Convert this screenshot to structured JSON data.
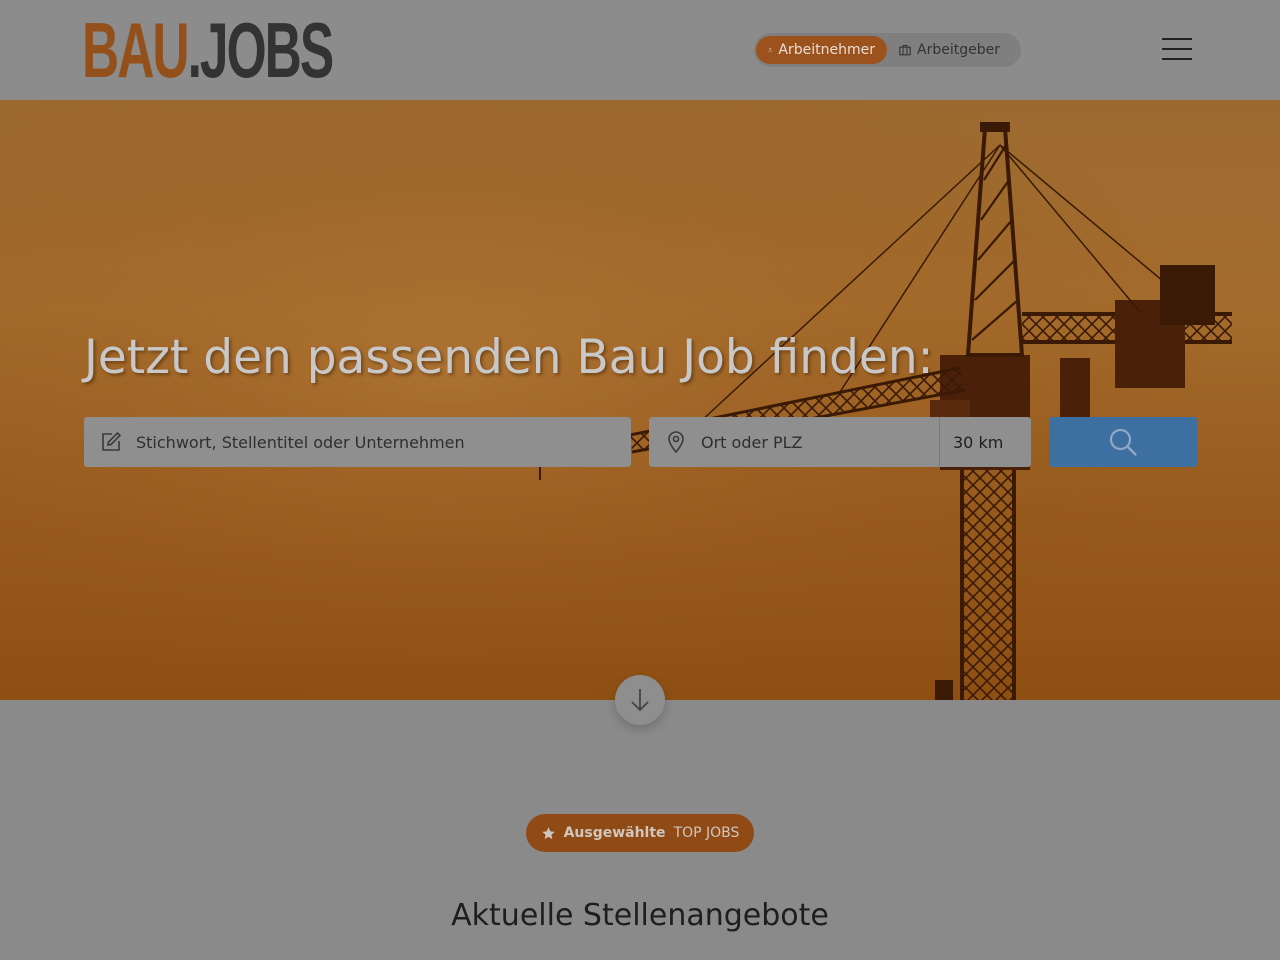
{
  "header": {
    "logo": {
      "part_a": "BAU",
      "part_b": ".JOBS"
    },
    "roles": [
      {
        "label": "Arbeitnehmer",
        "icon": "person-icon",
        "active": true
      },
      {
        "label": "Arbeitgeber",
        "icon": "briefcase-icon",
        "active": false
      }
    ],
    "menu_icon": "hamburger-icon"
  },
  "hero": {
    "title": "Jetzt den passenden Bau Job finden:",
    "keyword_placeholder": "Stichwort, Stellentitel oder Unternehmen",
    "keyword_icon": "edit-icon",
    "location_placeholder": "Ort oder PLZ",
    "location_icon": "map-pin-icon",
    "radius": "30 km",
    "search_icon": "search-icon",
    "scroll_icon": "arrow-down-icon"
  },
  "top_jobs": {
    "icon": "star-icon",
    "label_bold": "Ausgewählte",
    "label": "TOP JOBS"
  },
  "section": {
    "title": "Aktuelle Stellenangebote"
  },
  "colors": {
    "brand_orange": "#93501a",
    "search_button": "#3d6fa0",
    "badge": "#8f4a16"
  }
}
